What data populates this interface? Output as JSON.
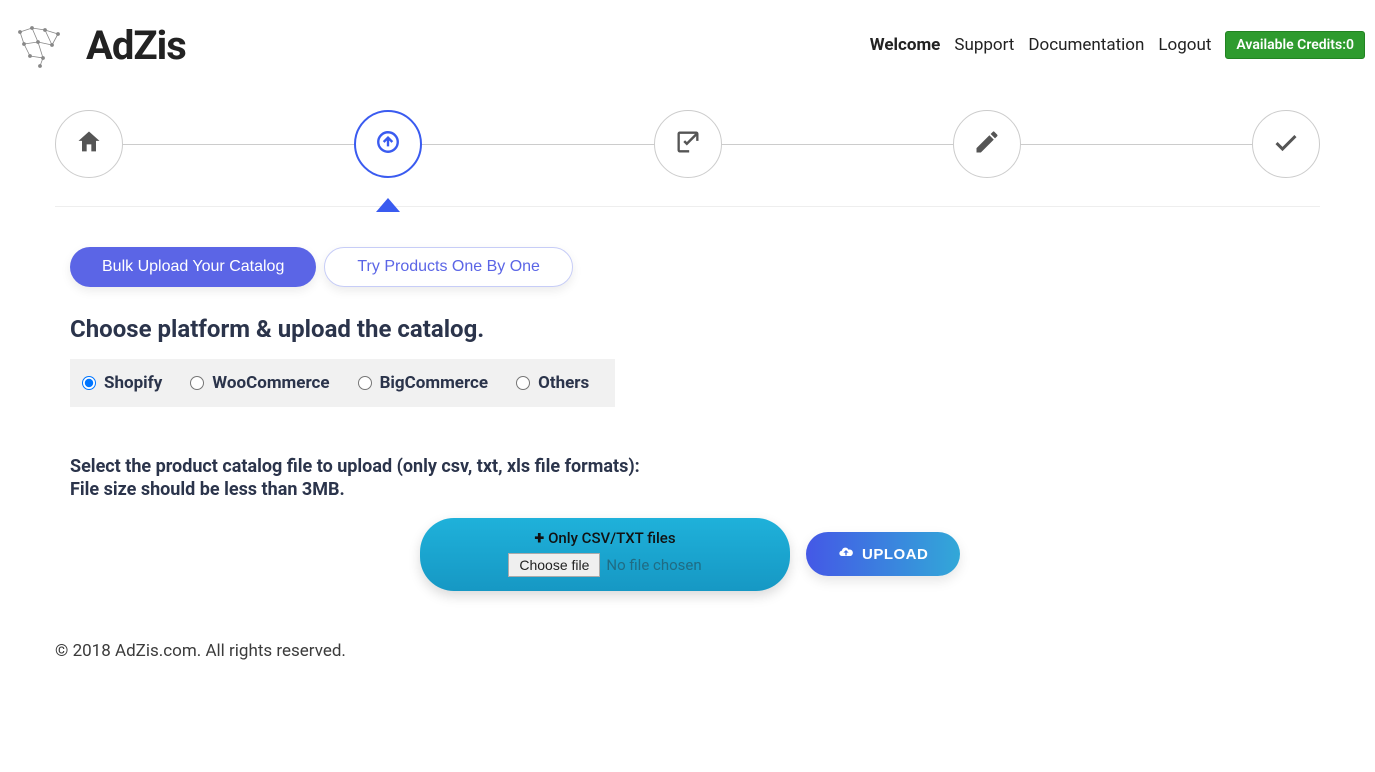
{
  "brand": "AdZis",
  "nav": {
    "welcome": "Welcome",
    "support": "Support",
    "documentation": "Documentation",
    "logout": "Logout",
    "credits_label": "Available Credits:0"
  },
  "steps": {
    "icons": [
      "home",
      "upload",
      "check-square",
      "pencil",
      "check"
    ],
    "active_index": 1
  },
  "tabs": {
    "bulk": "Bulk Upload Your Catalog",
    "single": "Try Products One By One"
  },
  "platform": {
    "title": "Choose platform & upload the catalog.",
    "options": [
      "Shopify",
      "WooCommerce",
      "BigCommerce",
      "Others"
    ],
    "selected": "Shopify"
  },
  "instruction_line1": "Select the product catalog file to upload (only csv, txt, xls file formats):",
  "instruction_line2": "File size should be less than 3MB.",
  "file_box": {
    "hint": "Only CSV/TXT files",
    "choose_label": "Choose file",
    "no_file": "No file chosen"
  },
  "upload_button": "UPLOAD",
  "footer": "© 2018 AdZis.com. All rights reserved."
}
